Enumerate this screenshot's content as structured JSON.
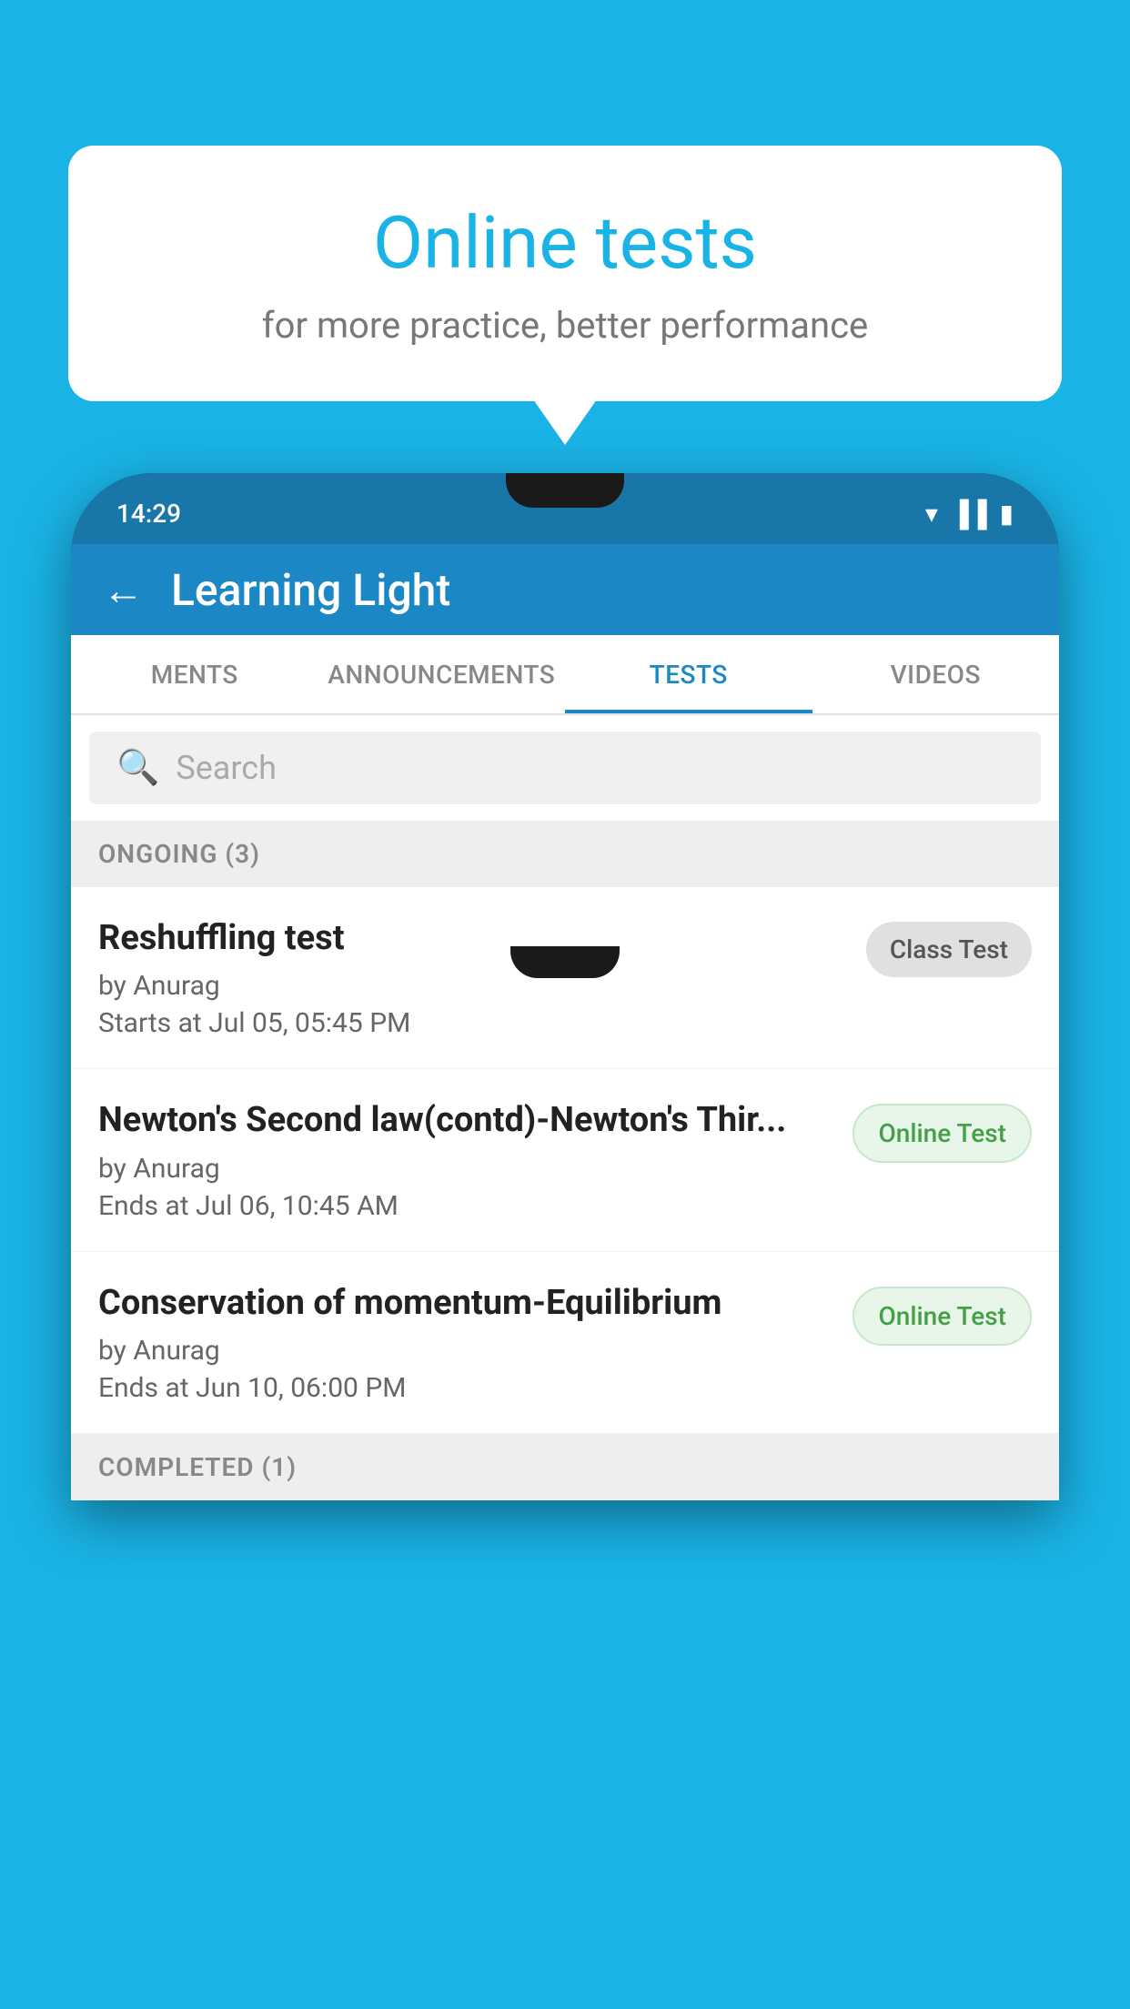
{
  "background_color": "#1ab3e6",
  "speech_bubble": {
    "title": "Online tests",
    "subtitle": "for more practice, better performance"
  },
  "status_bar": {
    "time": "14:29",
    "icons": [
      "wifi",
      "signal",
      "battery"
    ]
  },
  "app_header": {
    "title": "Learning Light",
    "back_label": "←"
  },
  "tabs": [
    {
      "label": "MENTS",
      "active": false
    },
    {
      "label": "ANNOUNCEMENTS",
      "active": false
    },
    {
      "label": "TESTS",
      "active": true
    },
    {
      "label": "VIDEOS",
      "active": false
    }
  ],
  "search": {
    "placeholder": "Search"
  },
  "sections": [
    {
      "title": "ONGOING (3)",
      "tests": [
        {
          "name": "Reshuffling test",
          "author": "by Anurag",
          "date": "Starts at  Jul 05, 05:45 PM",
          "badge": "Class Test",
          "badge_type": "class"
        },
        {
          "name": "Newton's Second law(contd)-Newton's Thir...",
          "author": "by Anurag",
          "date": "Ends at  Jul 06, 10:45 AM",
          "badge": "Online Test",
          "badge_type": "online"
        },
        {
          "name": "Conservation of momentum-Equilibrium",
          "author": "by Anurag",
          "date": "Ends at  Jun 10, 06:00 PM",
          "badge": "Online Test",
          "badge_type": "online"
        }
      ]
    }
  ],
  "completed_section": {
    "title": "COMPLETED (1)"
  }
}
